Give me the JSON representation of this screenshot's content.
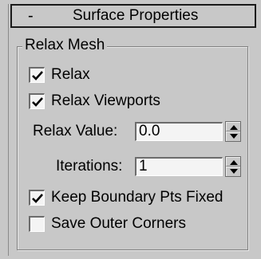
{
  "rollout": {
    "collapse_symbol": "-",
    "title": "Surface Properties"
  },
  "group": {
    "title": "Relax Mesh"
  },
  "checkboxes": {
    "relax": {
      "label": "Relax",
      "checked": true
    },
    "relax_viewports": {
      "label": "Relax Viewports",
      "checked": true
    },
    "keep_boundary": {
      "label": "Keep Boundary Pts Fixed",
      "checked": true
    },
    "save_outer_corners": {
      "label": "Save Outer Corners",
      "checked": false
    }
  },
  "fields": {
    "relax_value": {
      "label": "Relax Value:",
      "value": "0.0"
    },
    "iterations": {
      "label": "Iterations:",
      "value": "1"
    }
  },
  "icons": {
    "check": "checkmark-icon",
    "spin_up": "arrow-up-icon",
    "spin_down": "arrow-down-icon"
  },
  "colors": {
    "panel_bg": "#c8c8c8",
    "field_bg": "#f4f4f4",
    "text": "#000000"
  }
}
